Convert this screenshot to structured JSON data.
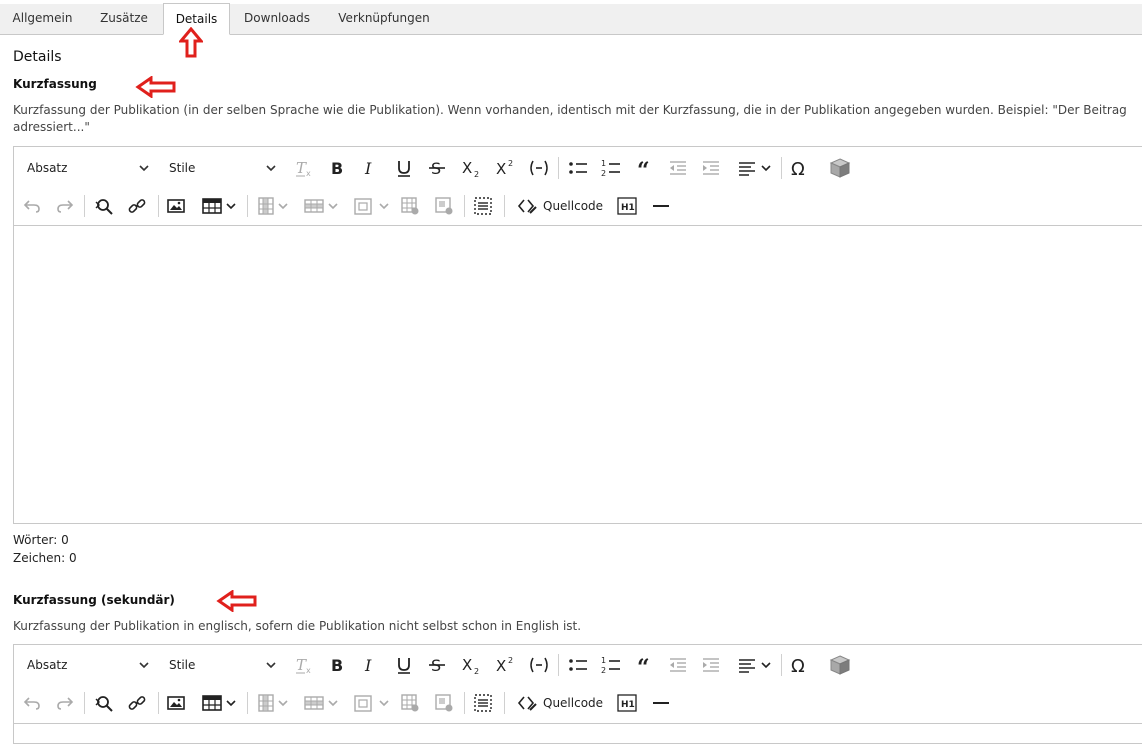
{
  "tabs": [
    {
      "label": "Allgemein",
      "active": false
    },
    {
      "label": "Zusätze",
      "active": false
    },
    {
      "label": "Details",
      "active": true
    },
    {
      "label": "Downloads",
      "active": false
    },
    {
      "label": "Verknüpfungen",
      "active": false
    }
  ],
  "section_title": "Details",
  "fields": [
    {
      "label": "Kurzfassung",
      "description": "Kurzfassung der Publikation (in der selben Sprache wie die Publikation). Wenn vorhanden, identisch mit der Kurzfassung, die in der Publikation angegeben wurden. Beispiel: \"Der Beitrag adressiert...\"",
      "words": "Wörter: 0",
      "chars": "Zeichen: 0"
    },
    {
      "label": "Kurzfassung (sekundär)",
      "description": "Kurzfassung der Publikation in englisch, sofern die Publikation nicht selbst schon in English ist."
    }
  ],
  "toolbar": {
    "paragraph_format": "Absatz",
    "styles": "Stile",
    "source_label": "Quellcode",
    "h1_label": "H1"
  },
  "colors": {
    "arrow": "#e0201c",
    "border": "#c8c8c8"
  }
}
